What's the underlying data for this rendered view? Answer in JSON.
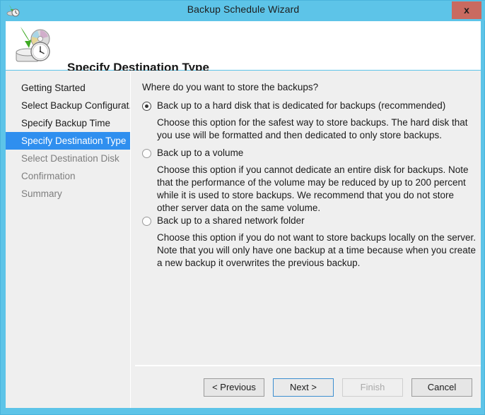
{
  "window": {
    "title": "Backup Schedule Wizard",
    "icon": "backup-schedule-icon",
    "close_label": "x",
    "accent_color": "#5dc4e8",
    "close_color": "#c96a60",
    "selection_color": "#2f8fef"
  },
  "header": {
    "icon": "backup-disk-clock-icon",
    "title": "Specify Destination Type"
  },
  "sidebar": {
    "items": [
      {
        "label": "Getting Started",
        "state": "done"
      },
      {
        "label": "Select Backup Configurat...",
        "state": "done"
      },
      {
        "label": "Specify Backup Time",
        "state": "done"
      },
      {
        "label": "Specify Destination Type",
        "state": "selected"
      },
      {
        "label": "Select Destination Disk",
        "state": "upcoming"
      },
      {
        "label": "Confirmation",
        "state": "upcoming"
      },
      {
        "label": "Summary",
        "state": "upcoming"
      }
    ]
  },
  "content": {
    "question": "Where do you want to store the backups?",
    "options": [
      {
        "label": "Back up to a hard disk that is dedicated for backups (recommended)",
        "description": "Choose this option for the safest way to store backups. The hard disk that you use will be formatted and then dedicated to only store backups.",
        "selected": true
      },
      {
        "label": "Back up to a volume",
        "description": "Choose this option if you cannot dedicate an entire disk for backups. Note that the performance of the volume may be reduced by up to 200 percent while it is used to store backups. We recommend that you do not store other server data on the same volume.",
        "selected": false
      },
      {
        "label": "Back up to a shared network folder",
        "description": "Choose this option if you do not want to store backups locally on the server. Note that you will only have one backup at a time because when you create a new backup it overwrites the previous backup.",
        "selected": false
      }
    ]
  },
  "footer": {
    "previous_label": "< Previous",
    "next_label": "Next >",
    "finish_label": "Finish",
    "cancel_label": "Cancel"
  }
}
